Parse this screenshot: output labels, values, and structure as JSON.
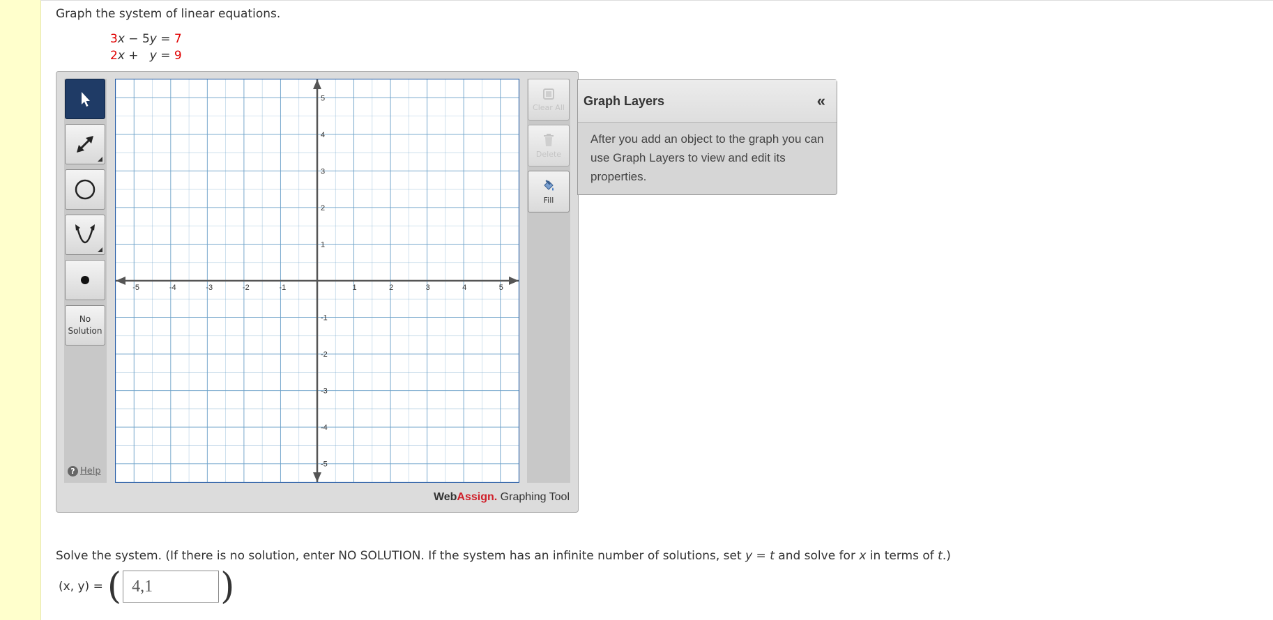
{
  "question": {
    "prompt": "Graph the system of linear equations.",
    "equations": [
      {
        "a": "3",
        "var1": "x",
        "op": "−",
        "b": "5",
        "var2": "y",
        "eq": "=",
        "c": "7"
      },
      {
        "a": "2",
        "var1": "x",
        "op": "+",
        "b": "",
        "var2": "y",
        "eq": "=",
        "c": "9"
      }
    ]
  },
  "tool": {
    "left_buttons": [
      {
        "name": "pointer-tool",
        "icon": "pointer-arrow-icon",
        "active": true
      },
      {
        "name": "line-tool",
        "icon": "double-arrow-line-icon",
        "active": false
      },
      {
        "name": "circle-tool",
        "icon": "circle-icon",
        "active": false
      },
      {
        "name": "parabola-tool",
        "icon": "parabola-icon",
        "active": false
      },
      {
        "name": "point-tool",
        "icon": "dot-icon",
        "active": false
      }
    ],
    "no_solution_line1": "No",
    "no_solution_line2": "Solution",
    "help_label": "Help",
    "clear_all_label": "Clear All",
    "delete_label": "Delete",
    "fill_label": "Fill",
    "brand_web": "Web",
    "brand_assign": "Assign.",
    "brand_rest": " Graphing Tool",
    "colors": {
      "grid": "#6aa0c8",
      "axis": "#555555",
      "active_button": "#1f3b66",
      "brand_red": "#d0202a"
    }
  },
  "graph": {
    "xmin": -5.5,
    "xmax": 5.5,
    "ymin": -5.5,
    "ymax": 5.5,
    "x_ticks": [
      -5,
      -4,
      -3,
      -2,
      -1,
      1,
      2,
      3,
      4,
      5
    ],
    "y_ticks": [
      5,
      4,
      3,
      2,
      1,
      -1,
      -2,
      -3,
      -4,
      -5
    ],
    "grid_step": 0.5
  },
  "layers": {
    "title": "Graph Layers",
    "collapse_icon": "«",
    "body": "After you add an object to the graph you can use Graph Layers to view and edit its properties."
  },
  "solve": {
    "text_start": "Solve the system. (If there is no solution, enter NO SOLUTION. If the system has an infinite number of solutions, set ",
    "y_var": "y",
    "eq_sign": " = ",
    "t_var": "t",
    "text_mid": " and solve for ",
    "x_var": "x",
    "text_mid2": " in terms of ",
    "t_var2": "t",
    "text_end": ".)",
    "answer_label": "(x, y) =",
    "answer_value": "4,1"
  }
}
